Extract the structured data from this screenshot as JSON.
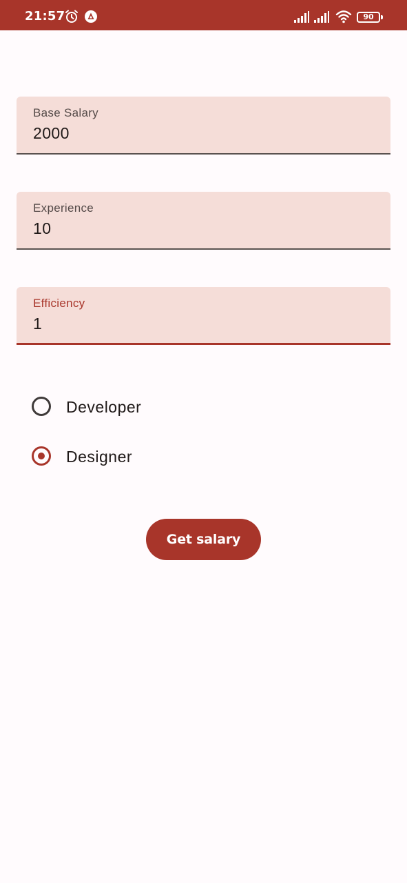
{
  "status_bar": {
    "time": "21:57",
    "battery": "90",
    "color": "#a8352a",
    "icons": [
      "alarm-icon",
      "app-icon",
      "signal-icon",
      "signal-icon",
      "wifi-icon",
      "battery-icon"
    ]
  },
  "form": {
    "fields": [
      {
        "label": "Base Salary",
        "value": "2000",
        "focused": false
      },
      {
        "label": "Experience",
        "value": "10",
        "focused": false
      },
      {
        "label": "Efficiency",
        "value": "1",
        "focused": true
      }
    ],
    "radio_options": [
      {
        "label": "Developer",
        "checked": false
      },
      {
        "label": "Designer",
        "checked": true
      }
    ],
    "submit_label": "Get salary"
  },
  "colors": {
    "accent": "#a8352a",
    "field_background": "#f5ddd8",
    "page_background": "#fffbfd"
  }
}
